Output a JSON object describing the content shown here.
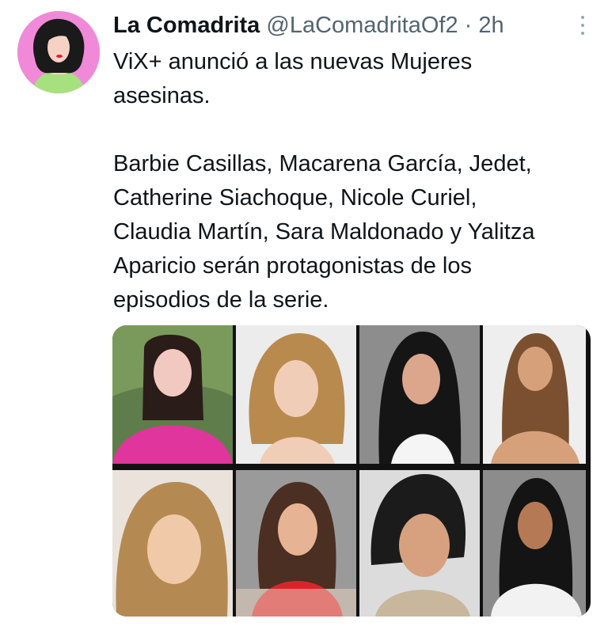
{
  "tweet": {
    "display_name": "La Comadrita",
    "handle": "@LaComadritaOf2",
    "separator": "·",
    "time": "2h",
    "text_lines": [
      "ViX+ anunció a las nuevas Mujeres",
      "asesinas.",
      "Barbie Casillas, Macarena García, Jedet,",
      "Catherine Siachoque, Nicole Curiel,",
      "Claudia Martín, Sara Maldonado y Yalitza",
      "Aparicio serán protagonistas de los",
      "episodios de la serie."
    ]
  },
  "icons": {
    "more": "more-vertical-icon",
    "avatar": "profile-avatar"
  },
  "colors": {
    "avatar_bg": "#f08ad8",
    "secondary_text": "#536471"
  }
}
